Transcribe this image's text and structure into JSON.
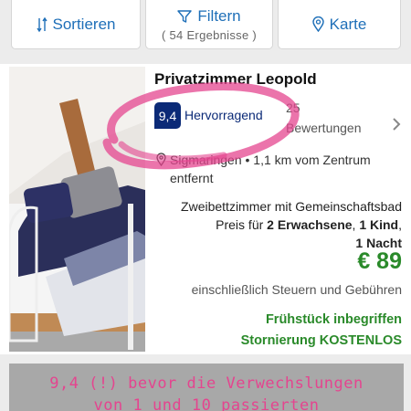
{
  "toolbar": {
    "sort_label": "Sortieren",
    "filter_label": "Filtern",
    "filter_results": "( 54 Ergebnisse )",
    "map_label": "Karte"
  },
  "listing": {
    "name": "Privatzimmer Leopold",
    "score": "9,4",
    "rating_word": "Hervorragend",
    "reviews_count": "25",
    "reviews_word": "Bewertungen",
    "location": "Sigmaringen • 1,1 km vom Zentrum entfernt",
    "room_type": "Zweibettzimmer mit Gemeinschaftsbad",
    "price_for_prefix": "Preis für",
    "adults": "2 Erwachsene",
    "children": "1 Kind",
    "nights": "1 Nacht",
    "price": "€ 89",
    "tax_note": "einschließlich Steuern und Gebühren",
    "perk_breakfast": "Frühstück inbegriffen",
    "perk_cancellation": "Stornierung KOSTENLOS"
  },
  "banner": {
    "line1": "9,4 (!) bevor die Verwechslungen",
    "line2": "von 1 und 10 passierten"
  },
  "colors": {
    "link_blue": "#1e6fb8",
    "score_navy": "#0b2a77",
    "price_green": "#2a8a2a",
    "marker_pink": "#e4458f"
  },
  "icons": [
    "sort-icon",
    "filter-icon",
    "map-pin-icon",
    "location-pin-icon",
    "chevron-right-icon"
  ]
}
